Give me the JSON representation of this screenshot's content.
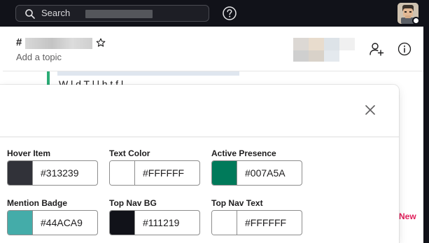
{
  "topbar": {
    "search_placeholder": "Search",
    "icons": {
      "search": "search-icon",
      "help": "help-icon",
      "avatar": "user-avatar"
    }
  },
  "channel": {
    "prefix": "#",
    "topic_placeholder": "Add a topic",
    "icons": {
      "star": "star-icon",
      "add_member": "add-member-icon",
      "info": "info-icon"
    }
  },
  "messages": {
    "partial_text": "W l     d  T  l           l    h t    f    l",
    "new_label": "New"
  },
  "modal": {
    "close_icon": "close-icon",
    "fields": [
      {
        "label": "Hover Item",
        "value": "#313239",
        "color": "#313239"
      },
      {
        "label": "Text Color",
        "value": "#FFFFFF",
        "color": "#FFFFFF"
      },
      {
        "label": "Active Presence",
        "value": "#007A5A",
        "color": "#007A5A"
      },
      {
        "label": "Mention Badge",
        "value": "#44ACA9",
        "color": "#44ACA9"
      },
      {
        "label": "Top Nav BG",
        "value": "#111219",
        "color": "#111219"
      },
      {
        "label": "Top Nav Text",
        "value": "#FFFFFF",
        "color": "#FFFFFF"
      }
    ]
  },
  "colors": {
    "topbar_bg": "#111219",
    "accent_green": "#2bac76",
    "new_label": "#e01e5a"
  }
}
